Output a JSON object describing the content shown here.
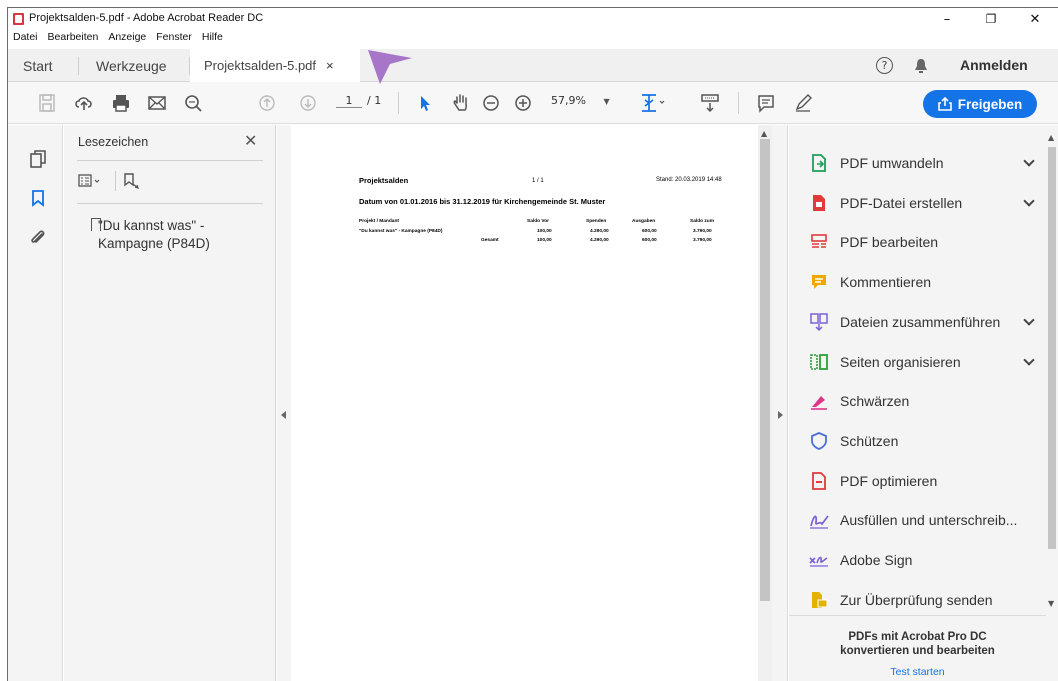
{
  "window": {
    "title": "Projektsalden-5.pdf - Adobe Acrobat Reader DC",
    "controls": {
      "minimize": "–",
      "restore": "❐",
      "close": "✕"
    }
  },
  "menu": [
    "Datei",
    "Bearbeiten",
    "Anzeige",
    "Fenster",
    "Hilfe"
  ],
  "tabs": {
    "start": "Start",
    "werkzeuge": "Werkzeuge",
    "document": "Projektsalden-5.pdf",
    "close": "×",
    "help": "?",
    "signin": "Anmelden"
  },
  "toolbar": {
    "page_current": "1",
    "page_total": "/ 1",
    "zoom": "57,9%",
    "share_label": "Freigeben"
  },
  "bookmarks": {
    "title": "Lesezeichen",
    "close": "✕",
    "items": [
      "\"Du kannst was\" - Kampagne (P84D)"
    ]
  },
  "document": {
    "title": "Projektsalden",
    "page_indicator": "1  /  1",
    "stand": "Stand: 20.03.2019 14:48",
    "subtitle": "Datum von 01.01.2016 bis 31.12.2019 für Kirchengemeinde St. Muster",
    "columns": [
      "Projekt / Mandant",
      "Saldo Vor",
      "Spenden",
      "Ausgaben",
      "Saldo zum"
    ],
    "rows": [
      {
        "name": "\"Du kannst was\" - Kampagne (P84D)",
        "saldo_vor": "100,00",
        "spenden": "4.290,00",
        "ausgaben": "600,00",
        "saldo_zum": "3.790,00"
      }
    ],
    "total": {
      "label": "Gesamt",
      "saldo_vor": "100,00",
      "spenden": "4.290,00",
      "ausgaben": "600,00",
      "saldo_zum": "3.790,00"
    }
  },
  "tools": [
    {
      "label": "PDF umwandeln",
      "icon": "export-pdf-icon",
      "color": "#1e9e5a",
      "dropdown": true
    },
    {
      "label": "PDF-Datei erstellen",
      "icon": "create-pdf-icon",
      "color": "#e03a3a",
      "dropdown": true
    },
    {
      "label": "PDF bearbeiten",
      "icon": "edit-pdf-icon",
      "color": "#e03a3a",
      "dropdown": false
    },
    {
      "label": "Kommentieren",
      "icon": "comment-icon",
      "color": "#f0a800",
      "dropdown": false
    },
    {
      "label": "Dateien zusammenführen",
      "icon": "combine-files-icon",
      "color": "#7b5fd6",
      "dropdown": true
    },
    {
      "label": "Seiten organisieren",
      "icon": "organize-pages-icon",
      "color": "#2e9e3a",
      "dropdown": true
    },
    {
      "label": "Schwärzen",
      "icon": "redact-icon",
      "color": "#e0368a",
      "dropdown": false
    },
    {
      "label": "Schützen",
      "icon": "protect-icon",
      "color": "#4b6fd6",
      "dropdown": false
    },
    {
      "label": "PDF optimieren",
      "icon": "optimize-pdf-icon",
      "color": "#e03a3a",
      "dropdown": false
    },
    {
      "label": "Ausfüllen und unterschreib...",
      "icon": "fill-sign-icon",
      "color": "#7b5fd6",
      "dropdown": false
    },
    {
      "label": "Adobe Sign",
      "icon": "adobe-sign-icon",
      "color": "#7b5fd6",
      "dropdown": false
    },
    {
      "label": "Zur Überprüfung senden",
      "icon": "send-review-icon",
      "color": "#e0b400",
      "dropdown": false
    }
  ],
  "promo": {
    "line1": "PDFs mit Acrobat Pro DC",
    "line2": "konvertieren und bearbeiten",
    "link": "Test starten"
  },
  "colors": {
    "accent": "#1473e6",
    "cursor": "#a776c9"
  }
}
